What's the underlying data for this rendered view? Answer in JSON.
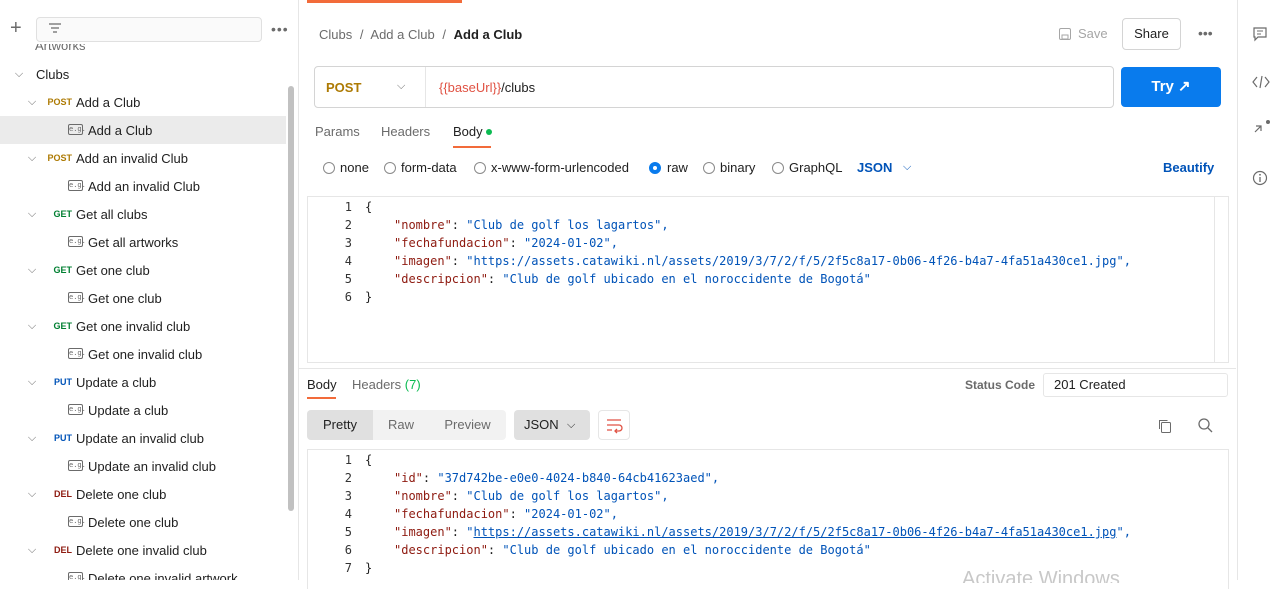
{
  "sidebar": {
    "top_partial_label": "Artworks",
    "tree": [
      {
        "kind": "folder",
        "label": "Clubs"
      },
      {
        "kind": "request",
        "method": "POST",
        "label": "Add a Club"
      },
      {
        "kind": "example",
        "label": "Add a Club",
        "selected": true
      },
      {
        "kind": "request",
        "method": "POST",
        "label": "Add an invalid Club"
      },
      {
        "kind": "example",
        "label": "Add an invalid Club"
      },
      {
        "kind": "request",
        "method": "GET",
        "label": "Get all clubs"
      },
      {
        "kind": "example",
        "label": "Get all artworks"
      },
      {
        "kind": "request",
        "method": "GET",
        "label": "Get one club"
      },
      {
        "kind": "example",
        "label": "Get one club"
      },
      {
        "kind": "request",
        "method": "GET",
        "label": "Get one invalid club"
      },
      {
        "kind": "example",
        "label": "Get one invalid club"
      },
      {
        "kind": "request",
        "method": "PUT",
        "label": "Update a club"
      },
      {
        "kind": "example",
        "label": "Update a club"
      },
      {
        "kind": "request",
        "method": "PUT",
        "label": "Update an invalid club"
      },
      {
        "kind": "example",
        "label": "Update an invalid club"
      },
      {
        "kind": "request",
        "method": "DEL",
        "label": "Delete one club"
      },
      {
        "kind": "example",
        "label": "Delete one club"
      },
      {
        "kind": "request",
        "method": "DEL",
        "label": "Delete one invalid club"
      },
      {
        "kind": "example",
        "label": "Delete one invalid artwork"
      }
    ]
  },
  "breadcrumb": {
    "a": "Clubs",
    "b": "Add a Club",
    "current": "Add a Club",
    "sep": "/"
  },
  "toolbar": {
    "save": "Save",
    "share": "Share"
  },
  "request": {
    "method": "POST",
    "url_var": "{{baseUrl}}",
    "url_path": "/clubs",
    "try": "Try ↗"
  },
  "req_tabs": {
    "params": "Params",
    "headers": "Headers",
    "body": "Body"
  },
  "body_types": {
    "none": "none",
    "form_data": "form-data",
    "urlencoded": "x-www-form-urlencoded",
    "raw": "raw",
    "binary": "binary",
    "graphql": "GraphQL",
    "format": "JSON",
    "beautify": "Beautify"
  },
  "request_body": [
    {
      "n": "1",
      "t": "{"
    },
    {
      "n": "2",
      "k": "\"nombre\"",
      "v": "\"Club de golf los lagartos\","
    },
    {
      "n": "3",
      "k": "\"fechafundacion\"",
      "v": "\"2024-01-02\","
    },
    {
      "n": "4",
      "k": "\"imagen\"",
      "v": "\"https://assets.catawiki.nl/assets/2019/3/7/2/f/5/2f5c8a17-0b06-4f26-b4a7-4fa51a430ce1.jpg\","
    },
    {
      "n": "5",
      "k": "\"descripcion\"",
      "v": "\"Club de golf ubicado en el noroccidente de Bogotá\""
    },
    {
      "n": "6",
      "t": "}"
    }
  ],
  "response": {
    "tab_body": "Body",
    "tab_headers": "Headers",
    "headers_count": "(7)",
    "status_label": "Status Code",
    "status_value": "201 Created",
    "view_pretty": "Pretty",
    "view_raw": "Raw",
    "view_preview": "Preview",
    "format": "JSON"
  },
  "response_body": [
    {
      "n": "1",
      "t": "{"
    },
    {
      "n": "2",
      "k": "\"id\"",
      "v": "\"37d742be-e0e0-4024-b840-64cb41623aed\","
    },
    {
      "n": "3",
      "k": "\"nombre\"",
      "v": "\"Club de golf los lagartos\","
    },
    {
      "n": "4",
      "k": "\"fechafundacion\"",
      "v": "\"2024-01-02\","
    },
    {
      "n": "5",
      "k": "\"imagen\"",
      "q1": "\"",
      "url": "https://assets.catawiki.nl/assets/2019/3/7/2/f/5/2f5c8a17-0b06-4f26-b4a7-4fa51a430ce1.jpg",
      "q2": "\","
    },
    {
      "n": "6",
      "k": "\"descripcion\"",
      "v": "\"Club de golf ubicado en el noroccidente de Bogotá\""
    },
    {
      "n": "7",
      "t": "}"
    }
  ],
  "watermark": "Activate Windows"
}
